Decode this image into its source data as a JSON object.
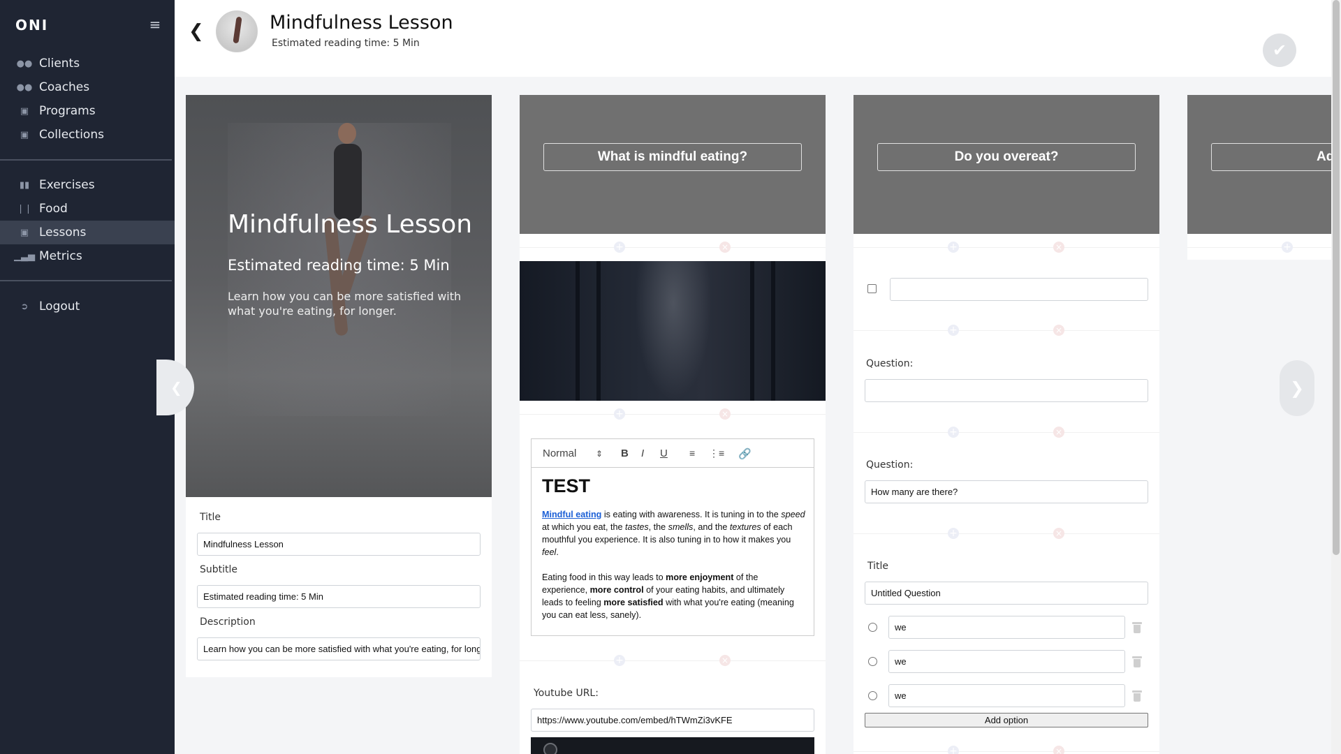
{
  "brand": {
    "logo": "ONI"
  },
  "sidebar": {
    "groups": [
      [
        {
          "label": "Clients",
          "icon": "clients-icon"
        },
        {
          "label": "Coaches",
          "icon": "coaches-icon"
        },
        {
          "label": "Programs",
          "icon": "programs-icon"
        },
        {
          "label": "Collections",
          "icon": "collections-icon"
        }
      ],
      [
        {
          "label": "Exercises",
          "icon": "exercises-icon"
        },
        {
          "label": "Food",
          "icon": "food-icon"
        },
        {
          "label": "Lessons",
          "icon": "lessons-icon",
          "active": true
        },
        {
          "label": "Metrics",
          "icon": "metrics-icon"
        }
      ],
      [
        {
          "label": "Logout",
          "icon": "logout-icon"
        }
      ]
    ]
  },
  "header": {
    "title": "Mindfulness Lesson",
    "subtitle": "Estimated reading time: 5 Min"
  },
  "cover": {
    "title": "Mindfulness Lesson",
    "subtitle": "Estimated reading time: 5 Min",
    "description": "Learn how you can be more satisfied with what you're eating, for longer.",
    "form": {
      "title_label": "Title",
      "title_value": "Mindfulness Lesson",
      "subtitle_label": "Subtitle",
      "subtitle_value": "Estimated reading time: 5 Min",
      "description_label": "Description",
      "description_value": "Learn how you can be more satisfied with what you're eating, for longer."
    }
  },
  "page2": {
    "heading": "What is mindful eating?",
    "editor": {
      "format_select": "Normal",
      "h1": "TEST",
      "p1_link": "Mindful eating",
      "p1_a": " is eating with awareness. It is tuning in to the ",
      "p1_speed": "speed",
      "p1_b": " at which you eat, the ",
      "p1_tastes": "tastes",
      "p1_c": ", the ",
      "p1_smells": "smells",
      "p1_d": ", and the ",
      "p1_textures": "textures",
      "p1_e": " of each mouthful you experience. It is also tuning in to how it makes you ",
      "p1_feel": "feel",
      "p1_f": ".",
      "p2_a": "Eating food in this way leads to ",
      "p2_b1": "more enjoyment",
      "p2_b": " of the experience, ",
      "p2_b2": "more control",
      "p2_c": " of your eating habits, and ultimately leads to feeling ",
      "p2_b3": "more satisfied",
      "p2_d": " with what you're eating (meaning you can eat less, sanely)."
    },
    "youtube_label": "Youtube URL:",
    "youtube_value": "https://www.youtube.com/embed/hTWmZi3vKFE"
  },
  "page3": {
    "heading": "Do you overeat?",
    "question1_label": "Question:",
    "question1_value": "",
    "question2_label": "Question:",
    "question2_value": "How many are there?",
    "title_label": "Title",
    "title_value": "Untitled Question",
    "options": [
      "we",
      "we",
      "we"
    ],
    "add_option": "Add option"
  },
  "page4": {
    "heading_partial": "Ad"
  }
}
